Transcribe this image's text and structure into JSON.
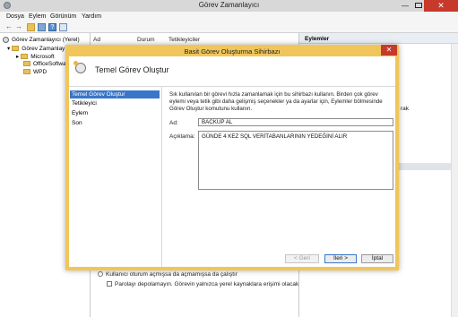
{
  "window": {
    "title": "Görev Zamanlayıcı",
    "close_glyph": "✕",
    "min_glyph": "—"
  },
  "menubar": [
    "Dosya",
    "Eylem",
    "Görünüm",
    "Yardım"
  ],
  "toolbar": {
    "icons": [
      "back-icon",
      "forward-icon",
      "folder-icon",
      "panel-icon",
      "help-icon",
      "properties-icon"
    ]
  },
  "tree": {
    "root": "Görev Zamanlayıcı (Yerel)",
    "library": "Görev Zamanlay",
    "children": [
      "Microsoft",
      "OfficeSoftwa",
      "WPD"
    ]
  },
  "list": {
    "columns": [
      "Ad",
      "Durum",
      "Tetikleyiciler"
    ],
    "option_radio": "Kullanıcı oturum açmışsa da açmamışsa da çalıştır",
    "option_check": "Parolayı depolamayın. Görevin yalnızca yerel kaynaklara erişimi olacak"
  },
  "actions_pane": {
    "header": "Eylemler",
    "fragment": "rak"
  },
  "dialog": {
    "title": "Basit Görev Oluşturma Sihirbazı",
    "close_glyph": "✕",
    "header_title": "Temel Görev Oluştur",
    "steps": [
      "Temel Görev Oluştur",
      "Tetikleyici",
      "Eylem",
      "Son"
    ],
    "description": "Sık kullanılan bir görevi hızla zamanlamak için bu sihirbazı kullanın. Birden çok görev eylemi veya tetik gibi daha gelişmiş seçenekler ya da ayarlar için, Eylemler bölmesinde Görev Oluştur komutunu kullanın.",
    "name_label": "Ad:",
    "name_value": "BACKUP AL",
    "desc_label": "Açıklama:",
    "desc_value": "GÜNDE 4 KEZ SQL VERİTABANLARININ YEDEĞİNİ ALIR",
    "buttons": {
      "back": "< Geri",
      "next": "İleri >",
      "cancel": "İptal"
    }
  }
}
